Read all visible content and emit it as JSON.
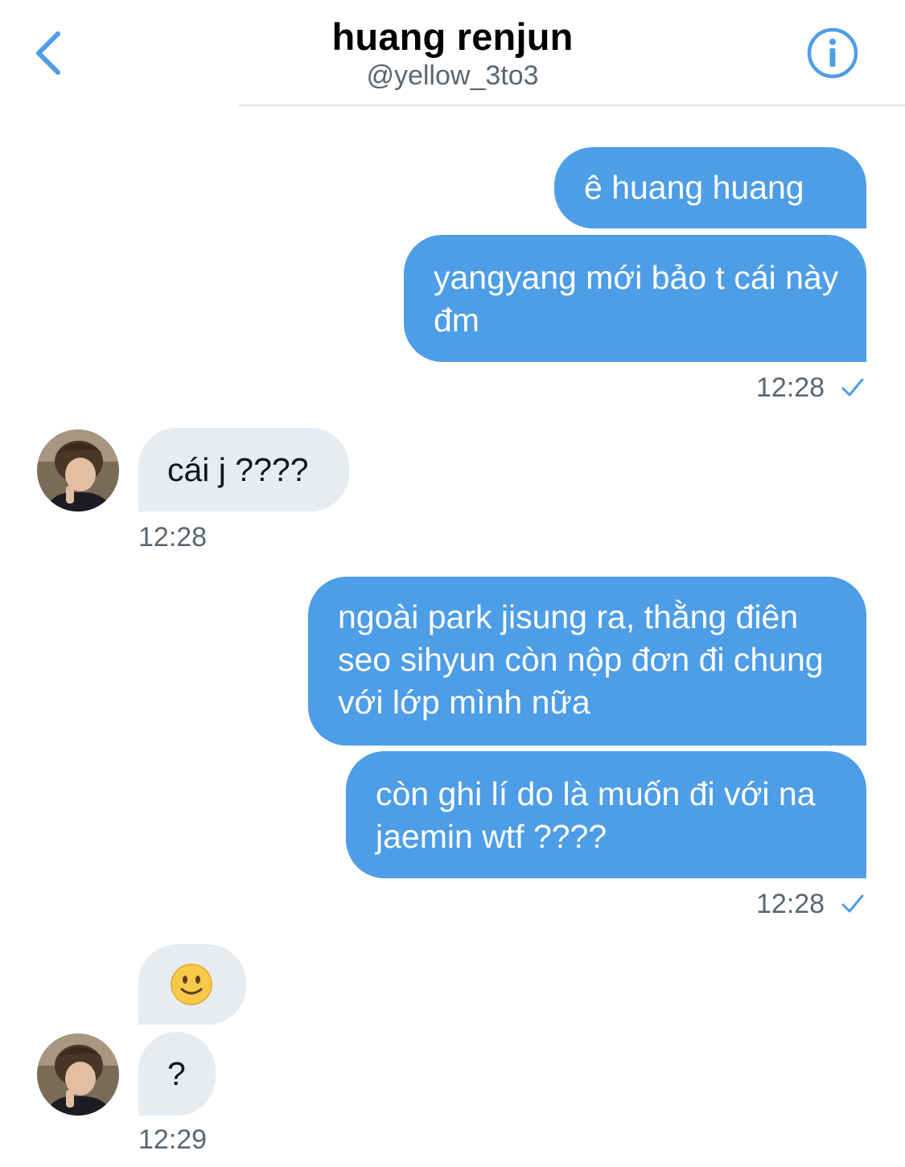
{
  "header": {
    "title": "huang renjun",
    "handle": "@yellow_3to3",
    "back_icon": "chevron-left-icon",
    "info_icon": "info-icon",
    "accent_color": "#4d9de7"
  },
  "conversation": {
    "outgoing_color": "#4d9de7",
    "incoming_color": "#e6ecf0",
    "groups": [
      {
        "sender": "me",
        "messages": [
          "ê huang huang",
          "yangyang mới bảo t cái này đm"
        ],
        "time": "12:28",
        "status_icon": "check-icon"
      },
      {
        "sender": "huang renjun",
        "messages": [
          "cái j ????"
        ],
        "time": "12:28"
      },
      {
        "sender": "me",
        "messages": [
          "ngoài park jisung ra, thằng điên seo sihyun còn nộp đơn đi chung với lớp mình nữa",
          "còn ghi lí do là muốn đi với na jaemin wtf ????"
        ],
        "time": "12:28",
        "status_icon": "check-icon"
      },
      {
        "sender": "huang renjun",
        "messages": [
          "🙂",
          "?"
        ],
        "time": "12:29"
      }
    ]
  }
}
